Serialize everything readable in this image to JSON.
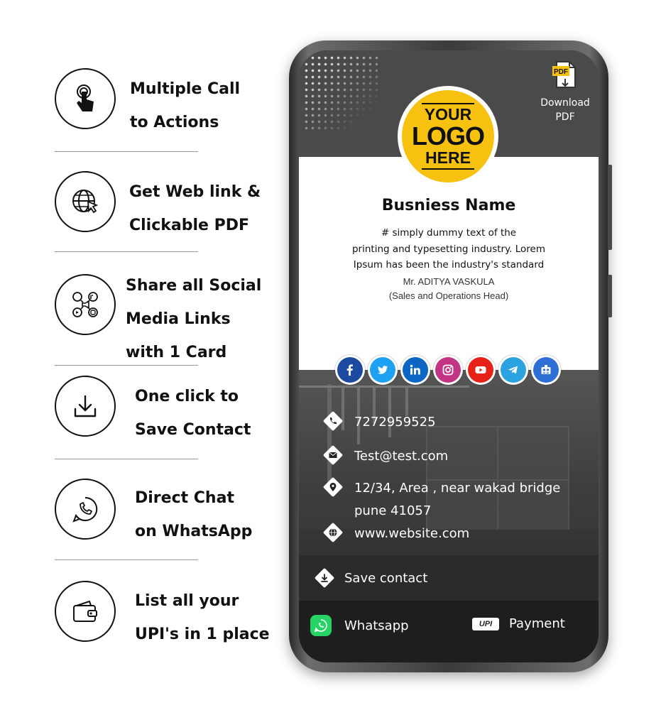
{
  "features": [
    {
      "icon": "hand-pointer-icon",
      "lines": [
        "Multiple Call",
        "to Actions"
      ]
    },
    {
      "icon": "globe-cursor-icon",
      "lines": [
        "Get Web link &",
        "Clickable PDF"
      ]
    },
    {
      "icon": "social-hub-icon",
      "lines": [
        "Share all Social",
        "Media Links",
        "with 1 Card"
      ]
    },
    {
      "icon": "download-icon",
      "lines": [
        "One click to",
        "Save Contact"
      ]
    },
    {
      "icon": "whatsapp-icon",
      "lines": [
        "Direct Chat",
        "on WhatsApp"
      ]
    },
    {
      "icon": "wallet-icon",
      "lines": [
        "List all your",
        "UPI's in 1 place"
      ]
    }
  ],
  "card": {
    "logo": [
      "YOUR",
      "LOGO",
      "HERE"
    ],
    "download_pdf": {
      "badge": "PDF",
      "lines": [
        "Download",
        "PDF"
      ]
    },
    "business_name": "Busniess Name",
    "description": [
      "# simply dummy text of the",
      "printing and typesetting industry. Lorem",
      "Ipsum has been the industry's standard"
    ],
    "person_name": "Mr. ADITYA VASKULA",
    "person_title": "(Sales and Operations Head)",
    "social": [
      {
        "name": "facebook",
        "color": "#1b4aa0"
      },
      {
        "name": "twitter",
        "color": "#1da1f2"
      },
      {
        "name": "linkedin",
        "color": "#0a66c2"
      },
      {
        "name": "instagram",
        "color": "#c13584"
      },
      {
        "name": "youtube",
        "color": "#e62117"
      },
      {
        "name": "telegram",
        "color": "#2aa3e0"
      },
      {
        "name": "group",
        "color": "#2e6fd6"
      }
    ],
    "contacts": {
      "phone": "7272959525",
      "email": "Test@test.com",
      "address": [
        "12/34, Area , near wakad bridge",
        "pune 41057"
      ],
      "website": "www.website.com"
    },
    "save_contact": "Save contact",
    "whatsapp": "Whatsapp",
    "upi_badge": "UPI",
    "payment": "Payment"
  }
}
